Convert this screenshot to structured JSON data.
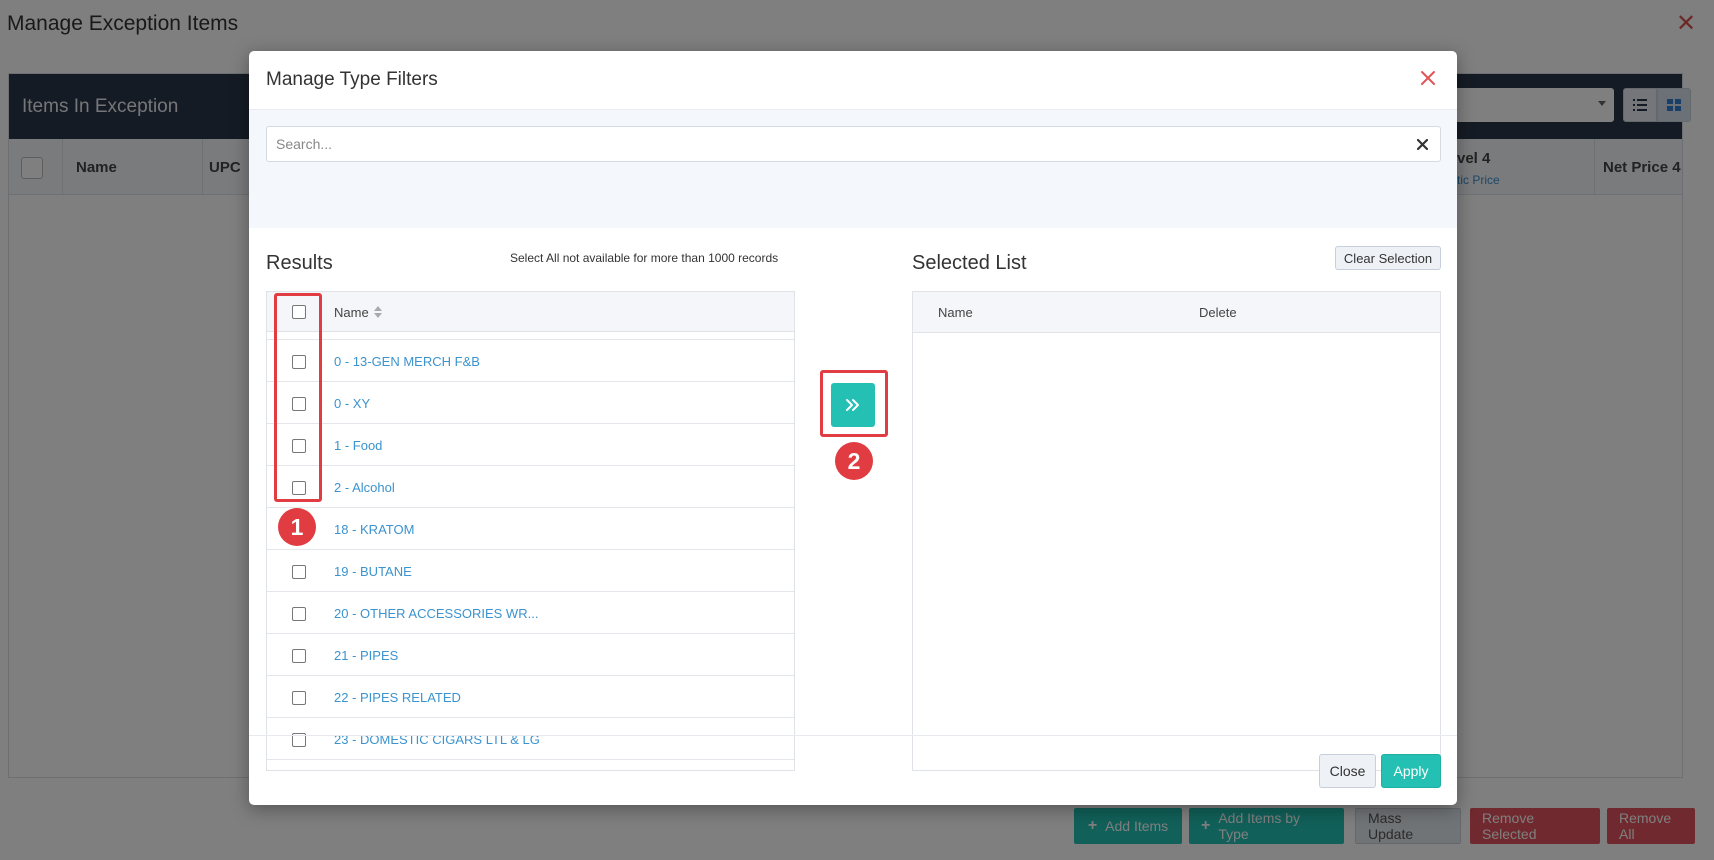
{
  "background": {
    "title": "Manage Exception Items",
    "panel_title": "Items In Exception",
    "columns": {
      "name": "Name",
      "upc": "UPC",
      "level4_partial": "vel 4",
      "level4_sub_partial": "tic Price",
      "net_price4": "Net Price 4"
    },
    "buttons": {
      "add_items": "Add Items",
      "add_items_by_type": "Add Items by Type",
      "mass_update": "Mass Update",
      "remove_selected": "Remove Selected",
      "remove_all": "Remove All"
    }
  },
  "modal": {
    "title": "Manage Type Filters",
    "search": {
      "placeholder": "Search...",
      "value": ""
    },
    "results": {
      "title": "Results",
      "note": "Select All not available for more than 1000 records",
      "column_name": "Name",
      "rows": [
        {
          "label": "0 - 13-GEN MERCH F&B",
          "checked": false
        },
        {
          "label": "0 - XY",
          "checked": false
        },
        {
          "label": "1 - Food",
          "checked": false
        },
        {
          "label": "2 - Alcohol",
          "checked": false
        },
        {
          "label": "18 - KRATOM",
          "checked": false
        },
        {
          "label": "19 - BUTANE",
          "checked": false
        },
        {
          "label": "20 - OTHER ACCESSORIES WR...",
          "checked": false
        },
        {
          "label": "21 - PIPES",
          "checked": false
        },
        {
          "label": "22 - PIPES RELATED",
          "checked": false
        },
        {
          "label": "23 - DOMESTIC CIGARS LTL & LG",
          "checked": false
        }
      ]
    },
    "selected": {
      "title": "Selected List",
      "clear_label": "Clear Selection",
      "column_name": "Name",
      "column_delete": "Delete"
    },
    "footer": {
      "close_label": "Close",
      "apply_label": "Apply"
    }
  },
  "annotations": {
    "step1": "1",
    "step2": "2"
  },
  "colors": {
    "accent": "#23c0b3",
    "link": "#3b93cf",
    "danger": "#e03c41",
    "header_dark": "#2a3649"
  },
  "icons": {
    "modal_close": "close-icon",
    "search_clear": "clear-icon",
    "move": "double-chevron-right-icon",
    "sort": "sort-icon"
  }
}
